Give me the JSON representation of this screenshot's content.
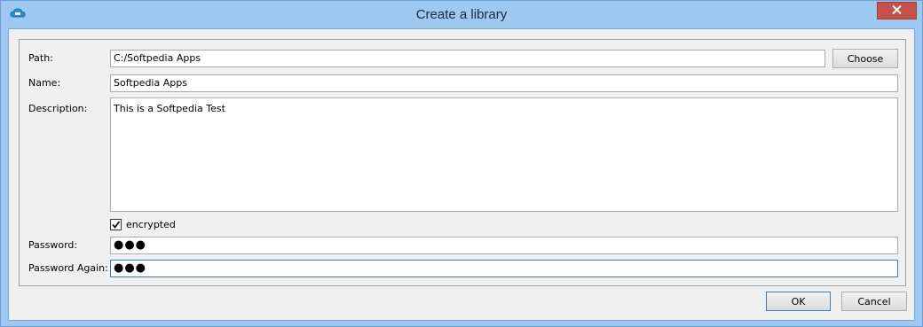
{
  "window": {
    "title": "Create a library",
    "app_icon": "cloud-library-icon",
    "close_icon": "close-icon"
  },
  "form": {
    "path_label": "Path:",
    "path_value": "C:/Softpedia Apps",
    "choose_label": "Choose",
    "name_label": "Name:",
    "name_value": "Softpedia Apps",
    "description_label": "Description:",
    "description_value": "This is a Softpedia Test",
    "encrypted_label": "encrypted",
    "encrypted_checked": true,
    "password_label": "Password:",
    "password_value": "●●●",
    "password_again_label": "Password Again:",
    "password_again_value": "●●●"
  },
  "buttons": {
    "ok_label": "OK",
    "cancel_label": "Cancel"
  },
  "colors": {
    "titlebar": "#9cc8f2",
    "close_button": "#c7504a",
    "focus_border": "#3c7fb1"
  }
}
